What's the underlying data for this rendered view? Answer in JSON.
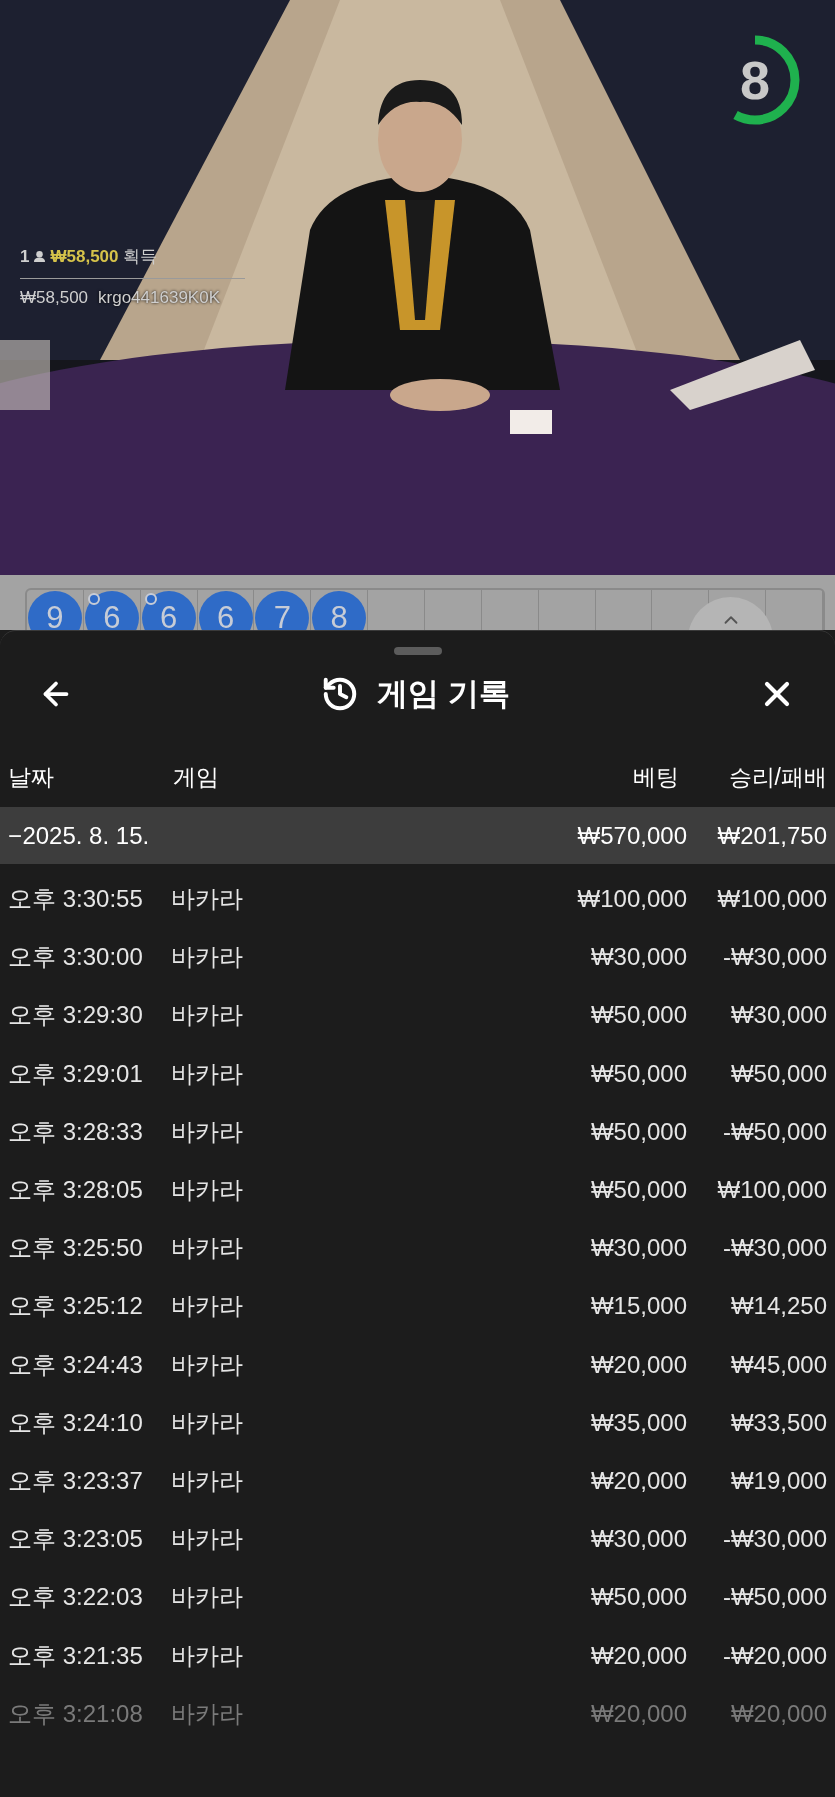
{
  "video": {
    "kind": "picture",
    "timer": {
      "count": "8",
      "level": 0.58
    },
    "winner": {
      "rank": "1",
      "amount": "₩58,500",
      "suffix": "획득",
      "payout": "₩58,500",
      "user": "krgo441639K0K"
    }
  },
  "bead_road": {
    "beads": [
      {
        "value": "9",
        "pair": false
      },
      {
        "value": "6",
        "pair": true
      },
      {
        "value": "6",
        "pair": true
      },
      {
        "value": "6",
        "pair": false
      },
      {
        "value": "7",
        "pair": false
      },
      {
        "value": "8",
        "pair": false
      }
    ]
  },
  "sheet": {
    "title": "게임 기록",
    "columns": [
      {
        "label": "날짜"
      },
      {
        "label": "게임"
      },
      {
        "label": "베팅"
      },
      {
        "label": "승리/패배"
      }
    ],
    "group": {
      "sign": "−",
      "date": "2025. 8. 15.",
      "bet": "₩570,000",
      "result": "₩201,750"
    },
    "rows": [
      {
        "time": "오후 3:30:55",
        "game": "바카라",
        "bet": "₩100,000",
        "result": "₩100,000",
        "dimmed": false
      },
      {
        "time": "오후 3:30:00",
        "game": "바카라",
        "bet": "₩30,000",
        "result": "-₩30,000",
        "dimmed": false
      },
      {
        "time": "오후 3:29:30",
        "game": "바카라",
        "bet": "₩50,000",
        "result": "₩30,000",
        "dimmed": false
      },
      {
        "time": "오후 3:29:01",
        "game": "바카라",
        "bet": "₩50,000",
        "result": "₩50,000",
        "dimmed": false
      },
      {
        "time": "오후 3:28:33",
        "game": "바카라",
        "bet": "₩50,000",
        "result": "-₩50,000",
        "dimmed": false
      },
      {
        "time": "오후 3:28:05",
        "game": "바카라",
        "bet": "₩50,000",
        "result": "₩100,000",
        "dimmed": false
      },
      {
        "time": "오후 3:25:50",
        "game": "바카라",
        "bet": "₩30,000",
        "result": "-₩30,000",
        "dimmed": false
      },
      {
        "time": "오후 3:25:12",
        "game": "바카라",
        "bet": "₩15,000",
        "result": "₩14,250",
        "dimmed": false
      },
      {
        "time": "오후 3:24:43",
        "game": "바카라",
        "bet": "₩20,000",
        "result": "₩45,000",
        "dimmed": false
      },
      {
        "time": "오후 3:24:10",
        "game": "바카라",
        "bet": "₩35,000",
        "result": "₩33,500",
        "dimmed": false
      },
      {
        "time": "오후 3:23:37",
        "game": "바카라",
        "bet": "₩20,000",
        "result": "₩19,000",
        "dimmed": false
      },
      {
        "time": "오후 3:23:05",
        "game": "바카라",
        "bet": "₩30,000",
        "result": "-₩30,000",
        "dimmed": false
      },
      {
        "time": "오후 3:22:03",
        "game": "바카라",
        "bet": "₩50,000",
        "result": "-₩50,000",
        "dimmed": false
      },
      {
        "time": "오후 3:21:35",
        "game": "바카라",
        "bet": "₩20,000",
        "result": "-₩20,000",
        "dimmed": false
      },
      {
        "time": "오후 3:21:08",
        "game": "바카라",
        "bet": "₩20,000",
        "result": "₩20,000",
        "dimmed": true
      }
    ]
  }
}
